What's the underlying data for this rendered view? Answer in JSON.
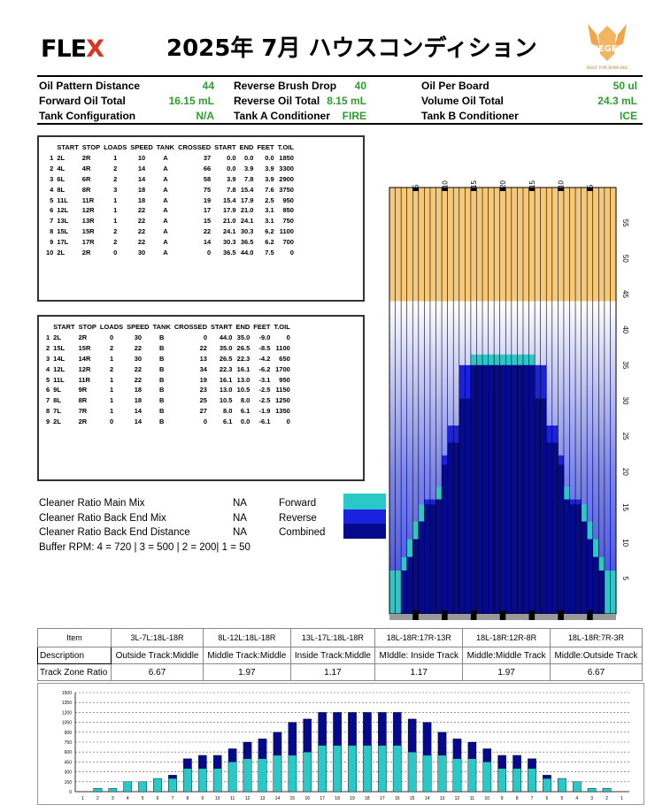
{
  "header": {
    "logo_flex_prefix": "FLE",
    "logo_flex_x": "X",
    "title": "2025年 7月 ハウスコンディション",
    "kegel_logo": "KEGEL",
    "kegel_tagline": "BUILT FOR BOWLING"
  },
  "stats": [
    [
      {
        "label": "Oil Pattern Distance",
        "value": "44"
      },
      {
        "label": "Reverse Brush Drop",
        "value": "40"
      },
      {
        "label": "Oil Per Board",
        "value": "50 ul"
      }
    ],
    [
      {
        "label": "Forward Oil Total",
        "value": "16.15 mL"
      },
      {
        "label": "Reverse Oil Total",
        "value": "8.15 mL"
      },
      {
        "label": "Volume Oil Total",
        "value": "24.3 mL"
      }
    ],
    [
      {
        "label": "Tank Configuration",
        "value": "N/A"
      },
      {
        "label": "Tank A Conditioner",
        "value": "FIRE"
      },
      {
        "label": "Tank B Conditioner",
        "value": "ICE"
      }
    ]
  ],
  "table_headers": [
    "START",
    "STOP",
    "LOADS",
    "SPEED",
    "TANK",
    "CROSSED",
    "START",
    "END",
    "FEET",
    "T.OIL"
  ],
  "forward_table": [
    [
      "1",
      "2L",
      "2R",
      "1",
      "10",
      "A",
      "37",
      "0.0",
      "0.0",
      "0.0",
      "1850"
    ],
    [
      "2",
      "4L",
      "4R",
      "2",
      "14",
      "A",
      "66",
      "0.0",
      "3.9",
      "3.9",
      "3300"
    ],
    [
      "3",
      "6L",
      "6R",
      "2",
      "14",
      "A",
      "58",
      "3.9",
      "7.8",
      "3.9",
      "2900"
    ],
    [
      "4",
      "8L",
      "8R",
      "3",
      "18",
      "A",
      "75",
      "7.8",
      "15.4",
      "7.6",
      "3750"
    ],
    [
      "5",
      "11L",
      "11R",
      "1",
      "18",
      "A",
      "19",
      "15.4",
      "17.9",
      "2.5",
      "950"
    ],
    [
      "6",
      "12L",
      "12R",
      "1",
      "22",
      "A",
      "17",
      "17.9",
      "21.0",
      "3.1",
      "850"
    ],
    [
      "7",
      "13L",
      "13R",
      "1",
      "22",
      "A",
      "15",
      "21.0",
      "24.1",
      "3.1",
      "750"
    ],
    [
      "8",
      "15L",
      "15R",
      "2",
      "22",
      "A",
      "22",
      "24.1",
      "30.3",
      "6.2",
      "1100"
    ],
    [
      "9",
      "17L",
      "17R",
      "2",
      "22",
      "A",
      "14",
      "30.3",
      "36.5",
      "6.2",
      "700"
    ],
    [
      "10",
      "2L",
      "2R",
      "0",
      "30",
      "A",
      "0",
      "36.5",
      "44.0",
      "7.5",
      "0"
    ]
  ],
  "reverse_table": [
    [
      "1",
      "2L",
      "2R",
      "0",
      "30",
      "B",
      "0",
      "44.0",
      "35.0",
      "-9.0",
      "0"
    ],
    [
      "2",
      "15L",
      "15R",
      "2",
      "22",
      "B",
      "22",
      "35.0",
      "26.5",
      "-8.5",
      "1100"
    ],
    [
      "3",
      "14L",
      "14R",
      "1",
      "30",
      "B",
      "13",
      "26.5",
      "22.3",
      "-4.2",
      "650"
    ],
    [
      "4",
      "12L",
      "12R",
      "2",
      "22",
      "B",
      "34",
      "22.3",
      "16.1",
      "-6.2",
      "1700"
    ],
    [
      "5",
      "11L",
      "11R",
      "1",
      "22",
      "B",
      "19",
      "16.1",
      "13.0",
      "-3.1",
      "950"
    ],
    [
      "6",
      "9L",
      "9R",
      "1",
      "18",
      "B",
      "23",
      "13.0",
      "10.5",
      "-2.5",
      "1150"
    ],
    [
      "7",
      "8L",
      "8R",
      "1",
      "18",
      "B",
      "25",
      "10.5",
      "8.0",
      "-2.5",
      "1250"
    ],
    [
      "8",
      "7L",
      "7R",
      "1",
      "14",
      "B",
      "27",
      "8.0",
      "6.1",
      "-1.9",
      "1350"
    ],
    [
      "9",
      "2L",
      "2R",
      "0",
      "14",
      "B",
      "0",
      "6.1",
      "0.0",
      "-6.1",
      "0"
    ]
  ],
  "cleaner": [
    {
      "label": "Cleaner Ratio Main Mix",
      "value": "NA",
      "legend": "Forward"
    },
    {
      "label": "Cleaner Ratio Back End Mix",
      "value": "NA",
      "legend": "Reverse"
    },
    {
      "label": "Cleaner Ratio Back End Distance",
      "value": "NA",
      "legend": "Combined"
    }
  ],
  "buffer_rpm": "Buffer RPM: 4 = 720 | 3 = 500 | 2 = 200| 1 = 50",
  "colors": {
    "forward": "#2bc8c8",
    "reverse": "#1a22dd",
    "combined": "#050a8c",
    "cleaner_top": "#f6c97a",
    "stat_value": "#2e9c2e",
    "brand_red": "#d9361f",
    "kegel": "#f0a64a"
  },
  "lane_chart": {
    "board_labels": [
      "5",
      "10",
      "15",
      "20",
      "15",
      "10",
      "5"
    ],
    "distance_labels": [
      "55",
      "50",
      "45",
      "40",
      "35",
      "30",
      "25",
      "20",
      "15",
      "10",
      "5"
    ],
    "boards": 39,
    "max_feet": 60,
    "cleaner_start_feet": 44,
    "forward_feet": [
      6.1,
      6.1,
      8.0,
      10.5,
      13.0,
      15.4,
      15.4,
      15.4,
      17.9,
      21.0,
      24.1,
      24.1,
      30.3,
      30.3,
      36.5,
      36.5,
      36.5,
      36.5,
      36.5,
      36.5,
      36.5,
      36.5,
      36.5,
      36.5,
      36.5,
      30.3,
      30.3,
      24.1,
      24.1,
      21.0,
      17.9,
      15.4,
      15.4,
      15.4,
      13.0,
      10.5,
      8.0,
      6.1,
      6.1
    ],
    "reverse_feet": [
      0,
      0,
      6.1,
      8.0,
      10.5,
      13.0,
      16.1,
      16.1,
      16.1,
      22.3,
      26.5,
      26.5,
      35.0,
      35.0,
      35.0,
      35.0,
      35.0,
      35.0,
      35.0,
      35.0,
      35.0,
      35.0,
      35.0,
      35.0,
      35.0,
      35.0,
      35.0,
      26.5,
      26.5,
      22.3,
      16.1,
      16.1,
      16.1,
      13.0,
      10.5,
      8.0,
      6.1,
      0,
      0
    ]
  },
  "zones": {
    "header_label": "Item",
    "ranges": [
      "3L-7L:18L-18R",
      "8L-12L:18L-18R",
      "13L-17L:18L-18R",
      "18L-18R:17R-13R",
      "18L-18R:12R-8R",
      "18L-18R:7R-3R"
    ],
    "description_label": "Description",
    "descriptions": [
      "Outside Track:Middle",
      "Middle Track:Middle",
      "Inside Track:Middle",
      "MIddle: Inside Track",
      "Middle:Middle Track",
      "Middle:Outside Track"
    ],
    "ratio_label": "Track Zone Ratio",
    "ratios": [
      "6.67",
      "1.97",
      "1.17",
      "1.17",
      "1.97",
      "6.67"
    ]
  },
  "chart_data": {
    "type": "bar",
    "title": "",
    "xlabel": "",
    "ylabel": "",
    "ylim": [
      0,
      1500
    ],
    "yticks": [
      0,
      150,
      300,
      450,
      600,
      750,
      900,
      1050,
      1200,
      1350,
      1500
    ],
    "grid": true,
    "categories": [
      "1",
      "2",
      "3",
      "4",
      "5",
      "6",
      "7",
      "8",
      "9",
      "10",
      "11",
      "12",
      "13",
      "14",
      "15",
      "16",
      "17",
      "18",
      "19",
      "18",
      "17",
      "16",
      "15",
      "14",
      "13",
      "12",
      "11",
      "10",
      "9",
      "8",
      "7",
      "6",
      "5",
      "4",
      "3",
      "2",
      "1"
    ],
    "series": [
      {
        "name": "Forward",
        "values": [
          0,
          50,
          50,
          150,
          150,
          200,
          200,
          350,
          350,
          350,
          450,
          500,
          500,
          550,
          550,
          600,
          700,
          700,
          700,
          700,
          700,
          700,
          600,
          550,
          550,
          500,
          500,
          450,
          350,
          350,
          350,
          200,
          200,
          150,
          50,
          50,
          0
        ]
      },
      {
        "name": "Combined",
        "values": [
          0,
          50,
          50,
          150,
          150,
          200,
          250,
          500,
          550,
          550,
          650,
          750,
          800,
          900,
          1050,
          1100,
          1200,
          1200,
          1200,
          1200,
          1200,
          1200,
          1100,
          1050,
          900,
          800,
          750,
          650,
          550,
          550,
          500,
          250,
          200,
          150,
          50,
          50,
          0
        ]
      }
    ]
  }
}
